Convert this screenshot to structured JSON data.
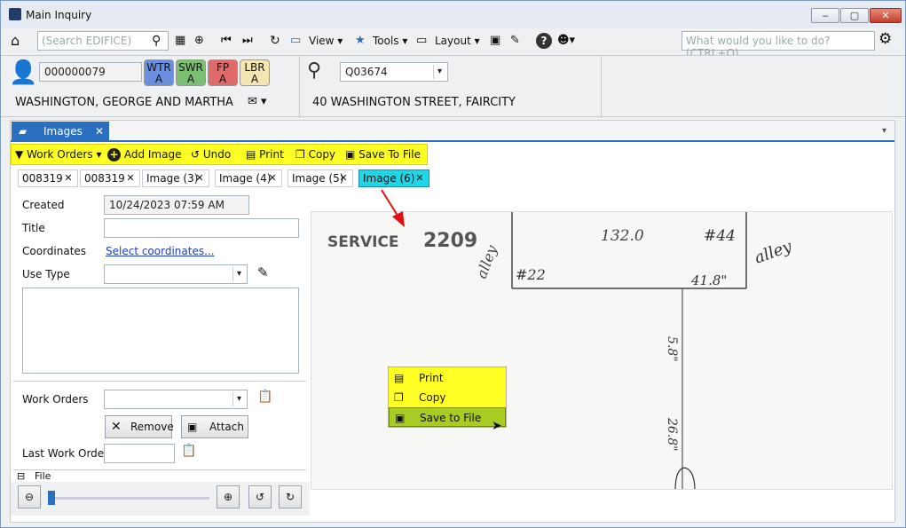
{
  "window": {
    "title": "Main Inquiry"
  },
  "toolbar": {
    "search_placeholder": "(Search EDIFICE)",
    "view_label": "View",
    "tools_label": "Tools",
    "layout_label": "Layout",
    "whatdo_placeholder": "What would you like to do? (CTRL+Q)"
  },
  "header": {
    "account": "000000079",
    "badges": [
      {
        "top": "WTR",
        "bottom": "A",
        "color": "#6a8fe0"
      },
      {
        "top": "SWR",
        "bottom": "A",
        "color": "#7bbf72"
      },
      {
        "top": "FP",
        "bottom": "A",
        "color": "#e06a6a"
      },
      {
        "top": "LBR",
        "bottom": "A",
        "color": "#f5e6b0"
      }
    ],
    "owner": "WASHINGTON,  GEORGE AND MARTHA",
    "location_id": "Q03674",
    "address": "40  WASHINGTON STREET,  FAIRCITY"
  },
  "panel": {
    "tab_label": "Images",
    "actions": {
      "work_orders": "Work Orders",
      "add_image": "Add Image",
      "undo": "Undo",
      "print": "Print",
      "copy": "Copy",
      "save_to_file": "Save To File"
    },
    "doc_tabs": [
      "008319",
      "008319",
      "Image (3)",
      "Image (4)",
      "Image (5)",
      "Image (6)"
    ]
  },
  "form": {
    "created_label": "Created",
    "created_value": "10/24/2023 07:59 AM",
    "title_label": "Title",
    "coordinates_label": "Coordinates",
    "coordinates_link": "Select coordinates...",
    "use_type_label": "Use Type",
    "work_orders_label": "Work Orders",
    "remove_label": "Remove",
    "attach_label": "Attach",
    "last_work_order_label": "Last Work Order",
    "file_label": "File"
  },
  "image": {
    "texts": {
      "service": "SERVICE",
      "num": "2209",
      "n132": "132.0",
      "h44": "#44",
      "alley": "alley",
      "alley2": "alley",
      "h22": "#22",
      "d418": "41.8\"",
      "d58": "5.8\"",
      "d26": "26.8\""
    }
  },
  "context_menu": {
    "items": [
      "Print",
      "Copy",
      "Save to File"
    ],
    "selected": "Save to File"
  }
}
